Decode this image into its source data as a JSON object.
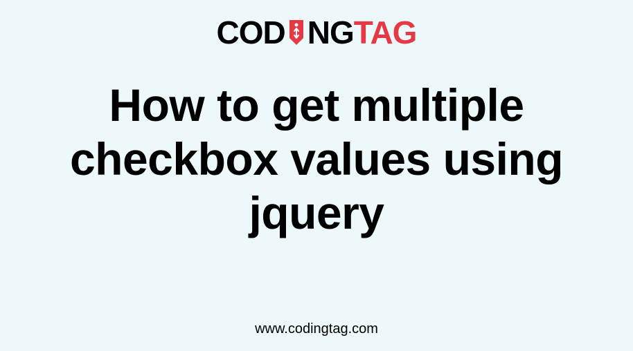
{
  "logo": {
    "part1": "COD",
    "part2": "NG",
    "part3": "TAG"
  },
  "heading": "How to get multiple checkbox values using jquery",
  "footer": {
    "url": "www.codingtag.com"
  }
}
